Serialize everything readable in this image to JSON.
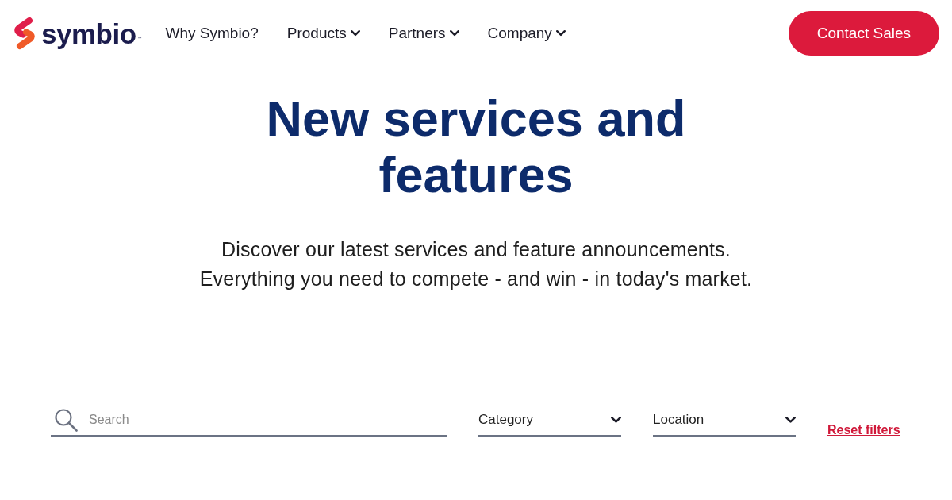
{
  "header": {
    "logo": {
      "name": "symbio",
      "trademark": "™"
    },
    "nav": [
      {
        "label": "Why Symbio?",
        "has_menu": false
      },
      {
        "label": "Products",
        "has_menu": true
      },
      {
        "label": "Partners",
        "has_menu": true
      },
      {
        "label": "Company",
        "has_menu": true
      }
    ],
    "cta": "Contact Sales"
  },
  "hero": {
    "title": "New services and features",
    "subtitle_lines": [
      "Discover our latest services and feature announcements.",
      "Everything you need to compete - and win - in today's market."
    ]
  },
  "filters": {
    "search": {
      "placeholder": "Search"
    },
    "selects": [
      {
        "label": "Category"
      },
      {
        "label": "Location"
      }
    ],
    "reset": "Reset filters"
  }
}
